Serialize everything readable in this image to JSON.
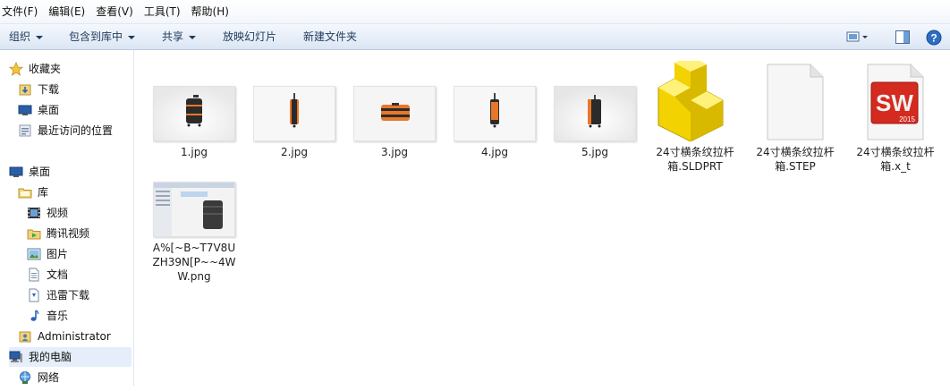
{
  "menu": {
    "items": [
      "文件(F)",
      "编辑(E)",
      "查看(V)",
      "工具(T)",
      "帮助(H)"
    ]
  },
  "toolbar": {
    "organize": "组织",
    "include_in_library": "包含到库中",
    "share": "共享",
    "slideshow": "放映幻灯片",
    "new_folder": "新建文件夹",
    "icons": [
      "view-options-icon",
      "preview-pane-icon",
      "help-icon"
    ]
  },
  "nav": {
    "favorites": "收藏夹",
    "downloads": "下载",
    "desktop_fav": "桌面",
    "recent": "最近访问的位置",
    "desktop": "桌面",
    "libraries": "库",
    "videos": "视频",
    "tencent_video": "腾讯视频",
    "pictures": "图片",
    "documents": "文档",
    "xunlei": "迅雷下载",
    "music": "音乐",
    "admin": "Administrator",
    "computer": "我的电脑",
    "network": "网络"
  },
  "files": [
    {
      "name": "1.jpg",
      "type": "jpg-thumbnail"
    },
    {
      "name": "2.jpg",
      "type": "jpg-thumbnail"
    },
    {
      "name": "3.jpg",
      "type": "jpg-thumbnail"
    },
    {
      "name": "4.jpg",
      "type": "jpg-thumbnail"
    },
    {
      "name": "5.jpg",
      "type": "jpg-thumbnail"
    },
    {
      "name": "24寸横条纹拉杆箱.SLDPRT",
      "type": "solidworks-part-icon"
    },
    {
      "name": "24寸横条纹拉杆箱.STEP",
      "type": "blank-document-icon"
    },
    {
      "name": "24寸横条纹拉杆箱.x_t",
      "type": "solidworks-2015-icon"
    },
    {
      "name": "A%[~B~T7V8UZH39N[P~~4WW.png",
      "type": "png-thumbnail"
    }
  ],
  "colors": {
    "toolbar_text": "#1e395b",
    "nav_selected": "#e5eefa",
    "suitcase_orange": "#e8772a",
    "suitcase_dark": "#2b2b2b"
  },
  "sw_badge": {
    "letters": "SW",
    "year": "2015"
  }
}
